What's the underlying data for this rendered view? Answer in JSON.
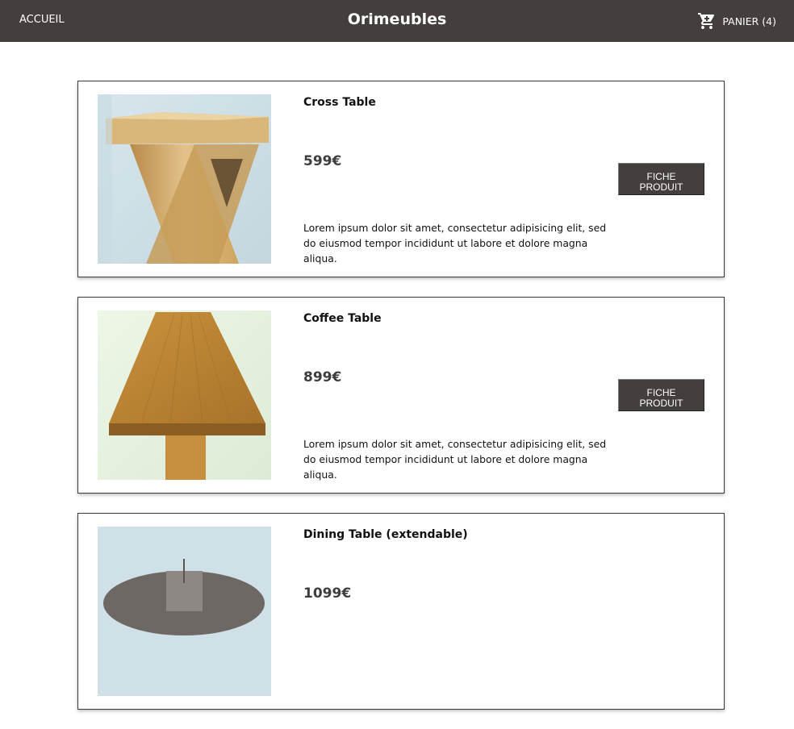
{
  "header": {
    "home_label": "ACCUEIL",
    "brand": "Orimeubles",
    "cart_label": "PANIER (4)",
    "cart_icon": "cart-plus-icon",
    "background_color": "#443f3d"
  },
  "products": [
    {
      "name": "Cross Table",
      "price": "599€",
      "description": "Lorem ipsum dolor sit amet, consectetur adipisicing elit, sed do eiusmod tempor incididunt ut labore et dolore magna aliqua.",
      "button_label": "FICHE PRODUIT",
      "image_subject": "cross-table-photo"
    },
    {
      "name": "Coffee Table",
      "price": "899€",
      "description": "Lorem ipsum dolor sit amet, consectetur adipisicing elit, sed do eiusmod tempor incididunt ut labore et dolore magna aliqua.",
      "button_label": "FICHE PRODUIT",
      "image_subject": "coffee-table-photo"
    },
    {
      "name": "Dining Table (extendable)",
      "price": "1099€",
      "description": "",
      "button_label": "",
      "image_subject": "dining-table-photo"
    }
  ],
  "colors": {
    "button_bg": "#443f3d",
    "card_border": "#3a3a3a",
    "price_text": "#3d3d3d"
  }
}
